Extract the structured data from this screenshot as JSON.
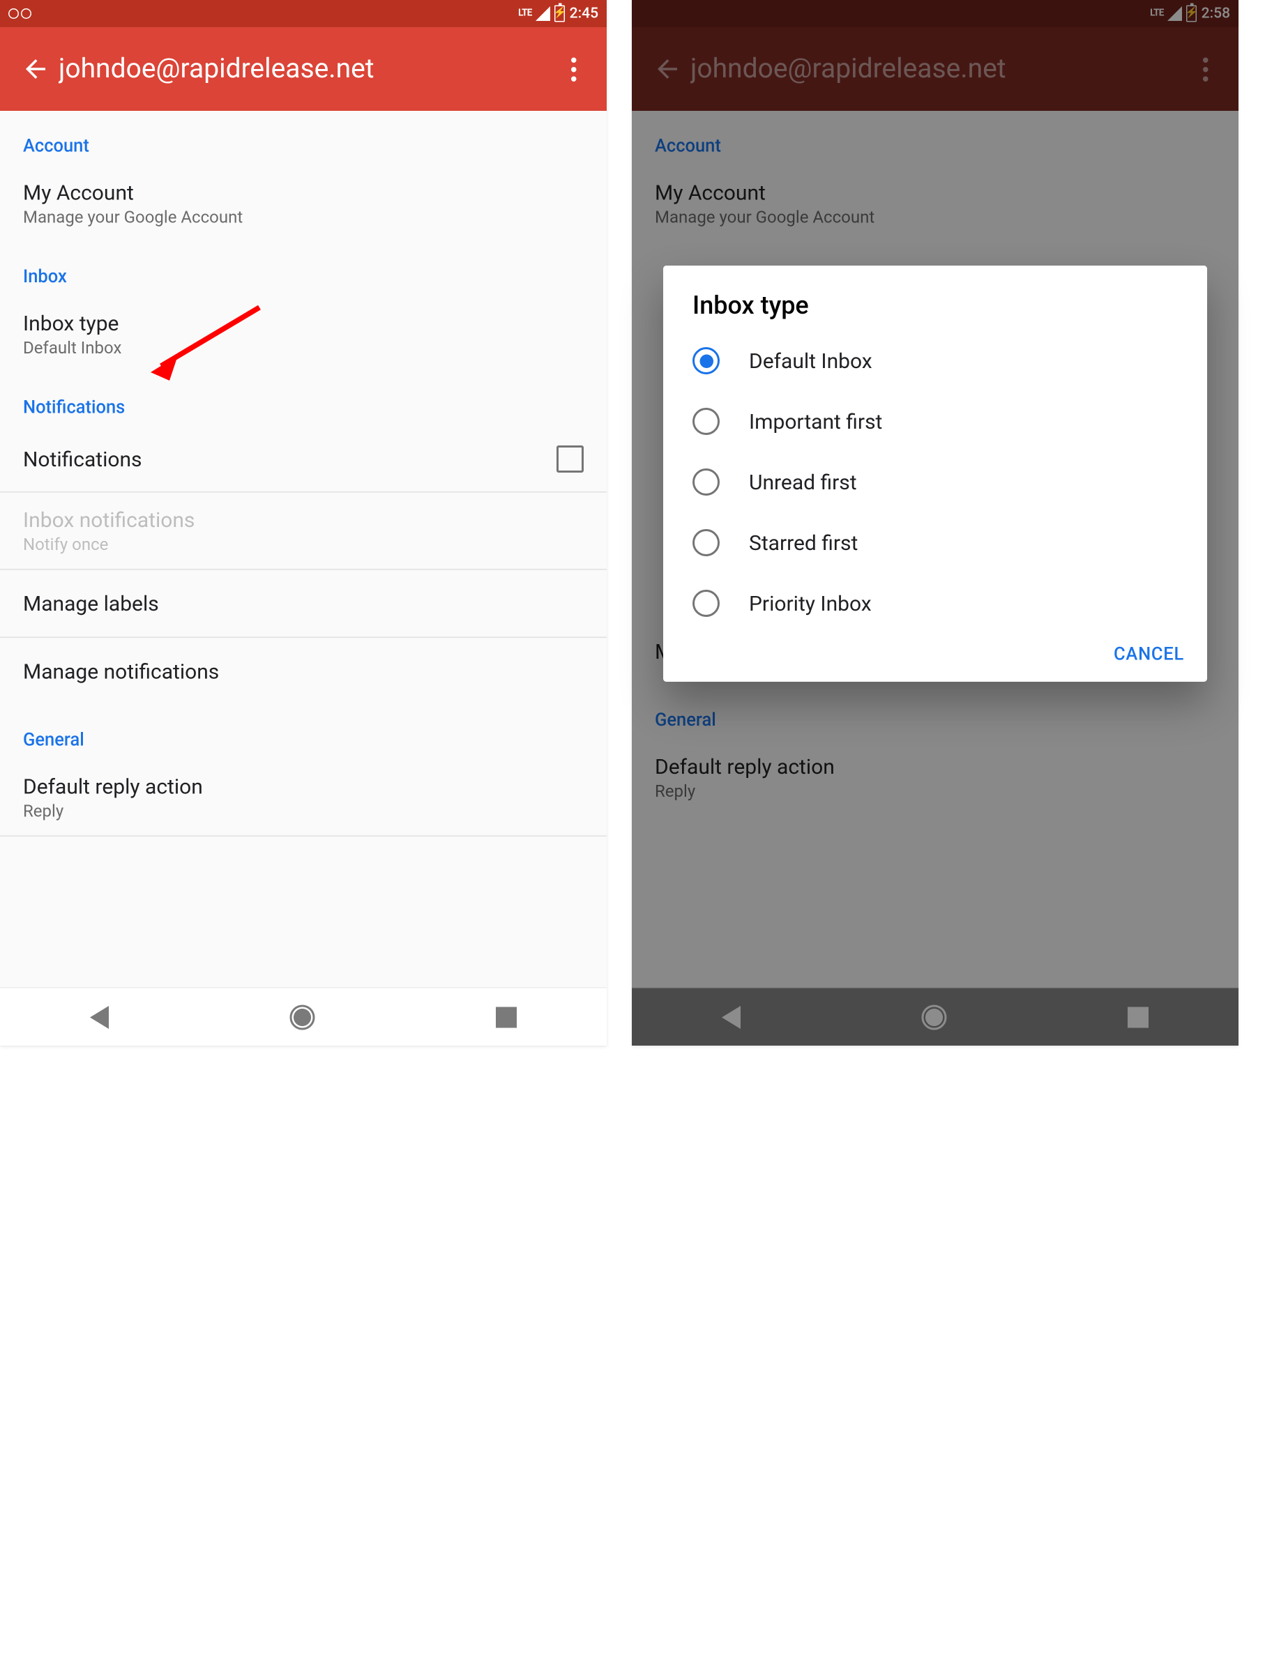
{
  "left": {
    "status_time": "2:45",
    "status_lte": "LTE",
    "appbar_title": "johndoe@rapidrelease.net",
    "sections": {
      "account": {
        "header": "Account",
        "my_account": {
          "title": "My Account",
          "subtitle": "Manage your Google Account"
        }
      },
      "inbox": {
        "header": "Inbox",
        "inbox_type": {
          "title": "Inbox type",
          "subtitle": "Default Inbox"
        }
      },
      "notifications": {
        "header": "Notifications",
        "notifications_row": "Notifications",
        "inbox_notifications": {
          "title": "Inbox notifications",
          "subtitle": "Notify once"
        },
        "manage_labels": "Manage labels",
        "manage_notifications": "Manage notifications"
      },
      "general": {
        "header": "General",
        "default_reply": {
          "title": "Default reply action",
          "subtitle": "Reply"
        }
      }
    }
  },
  "right": {
    "status_time": "2:58",
    "status_lte": "LTE",
    "appbar_title": "johndoe@rapidrelease.net",
    "dialog": {
      "title": "Inbox type",
      "options": [
        "Default Inbox",
        "Important first",
        "Unread first",
        "Starred first",
        "Priority Inbox"
      ],
      "selected_index": 0,
      "cancel": "CANCEL"
    },
    "sections": {
      "account": {
        "header": "Account",
        "my_account": {
          "title": "My Account",
          "subtitle": "Manage your Google Account"
        }
      },
      "notifications": {
        "manage_notifications": "Manage notifications"
      },
      "general": {
        "header": "General",
        "default_reply": {
          "title": "Default reply action",
          "subtitle": "Reply"
        }
      }
    }
  }
}
